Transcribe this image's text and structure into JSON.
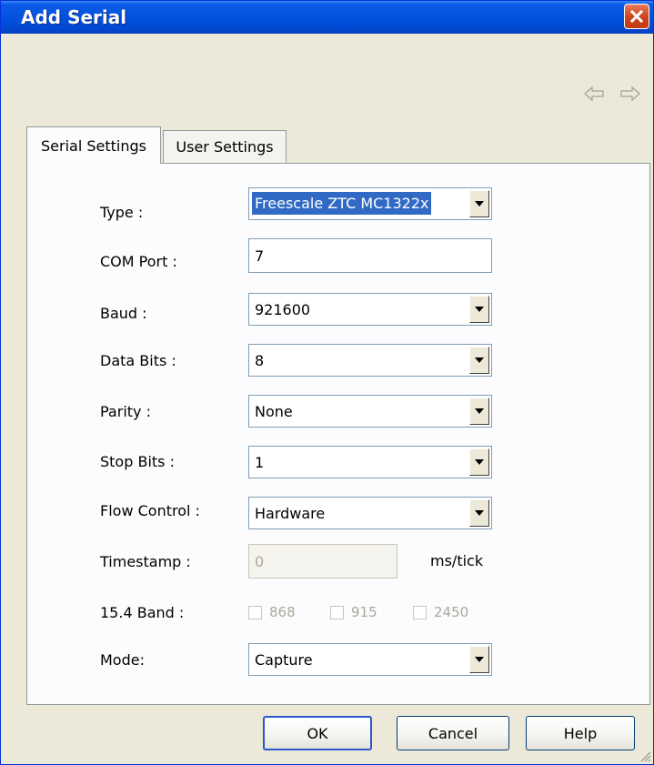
{
  "window": {
    "title": "Add Serial"
  },
  "tabs": [
    {
      "label": "Serial Settings",
      "active": true
    },
    {
      "label": "User Settings",
      "active": false
    }
  ],
  "fields": {
    "type": {
      "label": "Type :",
      "value": "Freescale ZTC MC1322x"
    },
    "com_port": {
      "label": "COM Port :",
      "value": "7"
    },
    "baud": {
      "label": "Baud :",
      "value": "921600"
    },
    "data_bits": {
      "label": "Data Bits :",
      "value": "8"
    },
    "parity": {
      "label": "Parity :",
      "value": "None"
    },
    "stop_bits": {
      "label": "Stop Bits :",
      "value": "1"
    },
    "flow_control": {
      "label": "Flow Control :",
      "value": "Hardware"
    },
    "timestamp": {
      "label": "Timestamp :",
      "value": "0",
      "suffix": "ms/tick",
      "disabled": true
    },
    "band": {
      "label": "15.4 Band :",
      "options": [
        "868",
        "915",
        "2450"
      ],
      "disabled": true
    },
    "mode": {
      "label": "Mode:",
      "value": "Capture"
    }
  },
  "buttons": {
    "ok": "OK",
    "cancel": "Cancel",
    "help": "Help"
  },
  "icons": [
    "close-icon",
    "back-arrow-icon",
    "forward-arrow-icon",
    "dropdown-arrow-icon",
    "resize-grip-icon"
  ],
  "colors": {
    "titlebar": "#0251de",
    "close": "#d0451f",
    "selection": "#316ac5",
    "face": "#ece9d8"
  }
}
